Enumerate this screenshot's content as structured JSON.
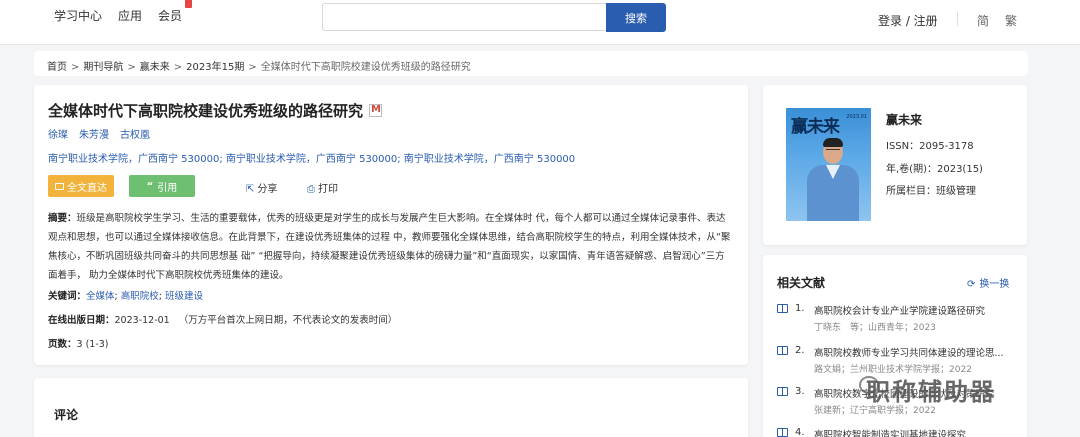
{
  "header": {
    "nav": [
      "学习中心",
      "应用",
      "会员"
    ],
    "search_placeholder": "",
    "search_button": "搜索",
    "login": "登录 / 注册",
    "lang_simplified": "简",
    "lang_traditional": "繁"
  },
  "breadcrumb": {
    "items": [
      "首页",
      "期刊导航",
      "赢未来",
      "2023年15期"
    ],
    "current": "全媒体时代下高职院校建设优秀班级的路径研究",
    "separator": ">"
  },
  "article": {
    "title": "全媒体时代下高职院校建设优秀班级的路径研究",
    "authors": [
      "徐璨",
      "朱芳漫",
      "古权凰"
    ],
    "affiliation": "南宁职业技术学院，广西南宁 530000; 南宁职业技术学院，广西南宁 530000; 南宁职业技术学院，广西南宁 530000",
    "fulltext_button": "全文直达",
    "cite_button": "引用",
    "share": "分享",
    "print": "打印",
    "abstract_label": "摘要：",
    "abstract": "班级是高职院校学生学习、生活的重要载体，优秀的班级更是对学生的成长与发展产生巨大影响。在全媒体时 代，每个人都可以通过全媒体记录事件、表达观点和思想，也可以通过全媒体接收信息。在此背景下，在建设优秀班集体的过程 中，教师要强化全媒体思维，结合高职院校学生的特点，利用全媒体技术，从“聚焦核心，不断巩固班级共同奋斗的共同思想基 础” “把握导向，持续凝聚建设优秀班级集体的磅礴力量”和“直面现实，以家国情、青年语答疑解惑、启智润心”三方面着手， 助力全媒体时代下高职院校优秀班集体的建设。",
    "keywords_label": "关键词：",
    "keywords": [
      "全媒体",
      "高职院校",
      "班级建设"
    ],
    "online_date_label": "在线出版日期：",
    "online_date": "2023-12-01",
    "online_date_note": "（万方平台首次上网日期，不代表论文的发表时间）",
    "pages_label": "页数：",
    "pages": "3 (1-3)"
  },
  "comments": {
    "title": "评论"
  },
  "journal": {
    "cover_title": "赢未来",
    "cover_issue": "2023.01",
    "name": "赢未来",
    "issn": "ISSN：2095-3178",
    "year_volume": "年,卷(期)：2023(15)",
    "column": "所属栏目：班级管理"
  },
  "related": {
    "title": "相关文献",
    "switch": "换一换",
    "items": [
      {
        "num": "1.",
        "title": "高职院校会计专业产业学院建设路径研究",
        "source": "丁晓东　等；山西青年；2023"
      },
      {
        "num": "2.",
        "title": "高职院校教师专业学习共同体建设的理论思...",
        "source": "路文娟；兰州职业技术学院学报；2022"
      },
      {
        "num": "3.",
        "title": "高职院校数字化校园建设的现状及对策研究",
        "source": "张建新；辽宁高职学报；2022"
      },
      {
        "num": "4.",
        "title": "高职院校智能制造实训基地建设探究",
        "source": ""
      }
    ]
  },
  "watermark": "职称辅助器",
  "colors": {
    "accent": "#2a5db0",
    "fulltext": "#f2b33d",
    "cite": "#6fbf73"
  }
}
